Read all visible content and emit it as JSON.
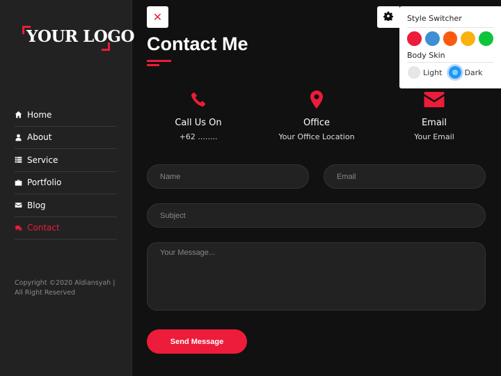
{
  "sidebar": {
    "logo_text": "YOUR LOGO",
    "nav": [
      {
        "label": "Home",
        "icon": "home-icon",
        "active": false
      },
      {
        "label": "About",
        "icon": "user-icon",
        "active": false
      },
      {
        "label": "Service",
        "icon": "list-icon",
        "active": false
      },
      {
        "label": "Portfolio",
        "icon": "briefcase-icon",
        "active": false
      },
      {
        "label": "Blog",
        "icon": "envelope-icon",
        "active": false
      },
      {
        "label": "Contact",
        "icon": "comments-icon",
        "active": true
      }
    ],
    "copyright": "Copyright ©2020 Aldiansyah | All Right Reserved"
  },
  "main": {
    "close_symbol": "✕",
    "title": "Contact Me",
    "info": [
      {
        "title": "Call Us On",
        "value": "+62 ........",
        "icon": "phone-icon"
      },
      {
        "title": "Office",
        "value": "Your Office Location",
        "icon": "map-marker-icon"
      },
      {
        "title": "Email",
        "value": "Your Email",
        "icon": "envelope-icon"
      }
    ],
    "form": {
      "name_placeholder": "Name",
      "email_placeholder": "Email",
      "subject_placeholder": "Subject",
      "message_placeholder": "Your Message...",
      "send_label": "Send Message"
    }
  },
  "style_switcher": {
    "gear_icon": "gear-icon",
    "title": "Style Switcher",
    "colors": [
      "#ec1c3a",
      "#3d8fd6",
      "#fa5b0f",
      "#f9b20f",
      "#0ec43a"
    ],
    "body_skin_title": "Body Skin",
    "light_label": "Light",
    "dark_label": "Dark",
    "selected_skin": "Dark"
  },
  "colors": {
    "accent": "#ec1c3a",
    "sidebar_bg": "#222222",
    "page_bg": "#111111"
  }
}
